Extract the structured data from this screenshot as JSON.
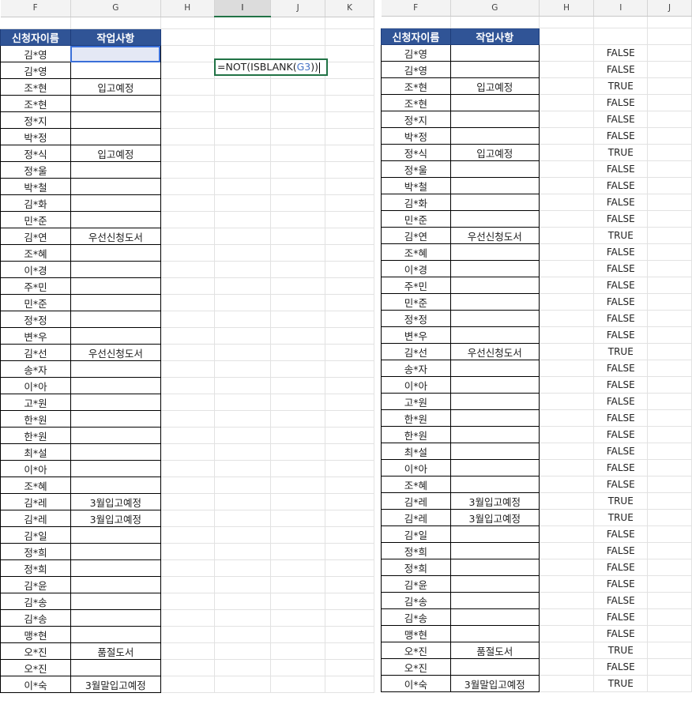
{
  "left": {
    "columns": [
      "F",
      "G",
      "H",
      "I",
      "J",
      "K"
    ],
    "selected_column": "I",
    "formula": {
      "prefix": "=NOT(ISBLANK(",
      "ref": "G3",
      "suffix": "))"
    }
  },
  "right": {
    "columns": [
      "F",
      "G",
      "H",
      "I",
      "J"
    ]
  },
  "table": {
    "header_name": "신청자이름",
    "header_task": "작업사항",
    "rows": [
      {
        "name": "김*영",
        "task": "",
        "result": "FALSE"
      },
      {
        "name": "김*영",
        "task": "",
        "result": "FALSE"
      },
      {
        "name": "조*현",
        "task": "입고예정",
        "result": "TRUE"
      },
      {
        "name": "조*현",
        "task": "",
        "result": "FALSE"
      },
      {
        "name": "정*지",
        "task": "",
        "result": "FALSE"
      },
      {
        "name": "박*정",
        "task": "",
        "result": "FALSE"
      },
      {
        "name": "정*식",
        "task": "입고예정",
        "result": "TRUE"
      },
      {
        "name": "정*울",
        "task": "",
        "result": "FALSE"
      },
      {
        "name": "박*철",
        "task": "",
        "result": "FALSE"
      },
      {
        "name": "김*화",
        "task": "",
        "result": "FALSE"
      },
      {
        "name": "민*준",
        "task": "",
        "result": "FALSE"
      },
      {
        "name": "김*연",
        "task": "우선신청도서",
        "result": "TRUE"
      },
      {
        "name": "조*혜",
        "task": "",
        "result": "FALSE"
      },
      {
        "name": "이*경",
        "task": "",
        "result": "FALSE"
      },
      {
        "name": "주*민",
        "task": "",
        "result": "FALSE"
      },
      {
        "name": "민*준",
        "task": "",
        "result": "FALSE"
      },
      {
        "name": "정*정",
        "task": "",
        "result": "FALSE"
      },
      {
        "name": "변*우",
        "task": "",
        "result": "FALSE"
      },
      {
        "name": "김*선",
        "task": "우선신청도서",
        "result": "TRUE"
      },
      {
        "name": "송*자",
        "task": "",
        "result": "FALSE"
      },
      {
        "name": "이*아",
        "task": "",
        "result": "FALSE"
      },
      {
        "name": "고*원",
        "task": "",
        "result": "FALSE"
      },
      {
        "name": "한*원",
        "task": "",
        "result": "FALSE"
      },
      {
        "name": "한*원",
        "task": "",
        "result": "FALSE"
      },
      {
        "name": "최*설",
        "task": "",
        "result": "FALSE"
      },
      {
        "name": "이*아",
        "task": "",
        "result": "FALSE"
      },
      {
        "name": "조*혜",
        "task": "",
        "result": "FALSE"
      },
      {
        "name": "김*레",
        "task": "3월입고예정",
        "result": "TRUE"
      },
      {
        "name": "김*레",
        "task": "3월입고예정",
        "result": "TRUE"
      },
      {
        "name": "김*일",
        "task": "",
        "result": "FALSE"
      },
      {
        "name": "정*희",
        "task": "",
        "result": "FALSE"
      },
      {
        "name": "정*희",
        "task": "",
        "result": "FALSE"
      },
      {
        "name": "김*윤",
        "task": "",
        "result": "FALSE"
      },
      {
        "name": "김*송",
        "task": "",
        "result": "FALSE"
      },
      {
        "name": "김*송",
        "task": "",
        "result": "FALSE"
      },
      {
        "name": "맹*현",
        "task": "",
        "result": "FALSE"
      },
      {
        "name": "오*진",
        "task": "품절도서",
        "result": "TRUE"
      },
      {
        "name": "오*진",
        "task": "",
        "result": "FALSE"
      },
      {
        "name": "이*숙",
        "task": "3월말입고예정",
        "result": "TRUE"
      }
    ]
  }
}
